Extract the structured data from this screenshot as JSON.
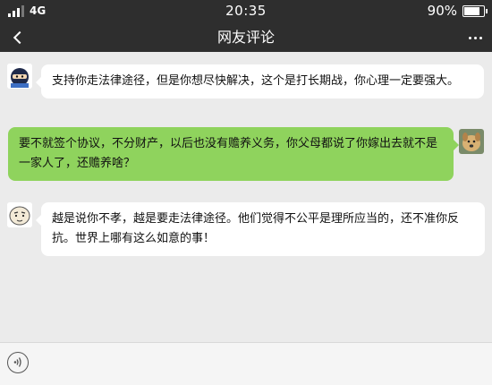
{
  "status_bar": {
    "network": "4G",
    "time": "20:35",
    "battery_percent": "90%",
    "battery_level": 0.9,
    "signal_bars_full": 3
  },
  "nav": {
    "title": "网友评论",
    "back_icon": "chevron-left-icon",
    "more_icon": "more-dots-icon"
  },
  "messages": [
    {
      "side": "left",
      "avatar": "ninja-avatar",
      "text": "支持你走法律途径，但是你想尽快解决，这个是打长期战，你心理一定要强大。"
    },
    {
      "side": "right",
      "avatar": "dog-avatar",
      "text": "要不就签个协议，不分财产，以后也没有赡养义务，你父母都说了你嫁出去就不是一家人了，还赡养啥？"
    },
    {
      "side": "left",
      "avatar": "cartoon-face-avatar",
      "text": "越是说你不孝，越是要走法律途径。他们觉得不公平是理所应当的，还不准你反抗。世界上哪有这么如意的事！"
    }
  ],
  "input_bar": {
    "voice_icon": "voice-icon"
  },
  "colors": {
    "header_bg": "#2e2e2e",
    "chat_bg": "#ebebeb",
    "self_bubble": "#8fd35d",
    "other_bubble": "#ffffff"
  }
}
